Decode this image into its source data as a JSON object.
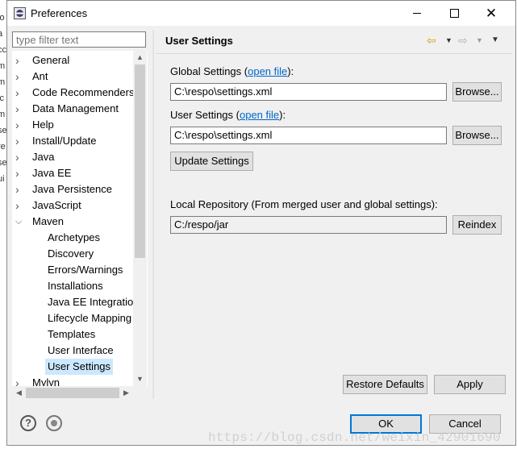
{
  "window": {
    "title": "Preferences"
  },
  "edge_fragments": [
    "lo",
    "a",
    "cc",
    "m",
    "m",
    "ic",
    "m",
    "se",
    "re",
    "se",
    "ui"
  ],
  "filter": {
    "placeholder": "type filter text"
  },
  "tree": [
    {
      "label": "General",
      "expanded": false,
      "level": 0
    },
    {
      "label": "Ant",
      "expanded": false,
      "level": 0
    },
    {
      "label": "Code Recommenders",
      "expanded": false,
      "level": 0
    },
    {
      "label": "Data Management",
      "expanded": false,
      "level": 0
    },
    {
      "label": "Help",
      "expanded": false,
      "level": 0
    },
    {
      "label": "Install/Update",
      "expanded": false,
      "level": 0
    },
    {
      "label": "Java",
      "expanded": false,
      "level": 0
    },
    {
      "label": "Java EE",
      "expanded": false,
      "level": 0
    },
    {
      "label": "Java Persistence",
      "expanded": false,
      "level": 0
    },
    {
      "label": "JavaScript",
      "expanded": false,
      "level": 0
    },
    {
      "label": "Maven",
      "expanded": true,
      "level": 0
    },
    {
      "label": "Archetypes",
      "level": 1
    },
    {
      "label": "Discovery",
      "level": 1
    },
    {
      "label": "Errors/Warnings",
      "level": 1
    },
    {
      "label": "Installations",
      "level": 1
    },
    {
      "label": "Java EE Integration",
      "level": 1
    },
    {
      "label": "Lifecycle Mapping",
      "level": 1
    },
    {
      "label": "Templates",
      "level": 1
    },
    {
      "label": "User Interface",
      "level": 1
    },
    {
      "label": "User Settings",
      "level": 1,
      "selected": true
    },
    {
      "label": "Mylyn",
      "expanded": false,
      "level": 0
    }
  ],
  "page": {
    "title": "User Settings",
    "global_label_prefix": "Global Settings (",
    "global_link": "open file",
    "global_label_suffix": "):",
    "global_value": "C:\\respo\\settings.xml",
    "user_label_prefix": "User Settings (",
    "user_link": "open file",
    "user_label_suffix": "):",
    "user_value": "C:\\respo\\settings.xml",
    "browse_label": "Browse...",
    "update_label": "Update Settings",
    "local_repo_label": "Local Repository (From merged user and global settings):",
    "local_repo_value": "C:/respo/jar",
    "reindex_label": "Reindex",
    "restore_label": "Restore Defaults",
    "apply_label": "Apply"
  },
  "footer": {
    "ok_label": "OK",
    "cancel_label": "Cancel",
    "watermark": "https://blog.csdn.net/weixin_42901690"
  },
  "colors": {
    "selection": "#cce8ff",
    "link": "#0066cc",
    "default_button_border": "#0078d7",
    "back_arrow": "#d4a017"
  }
}
